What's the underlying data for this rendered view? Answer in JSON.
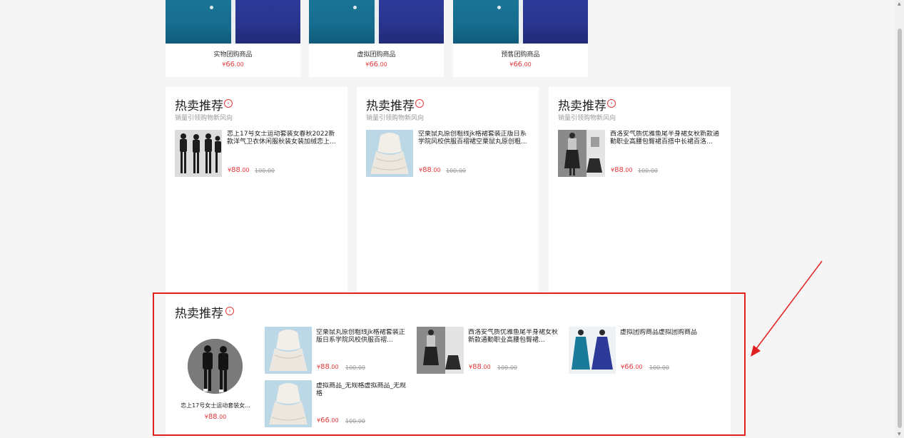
{
  "top_cards": [
    {
      "name": "实物团购商品",
      "currency": "¥",
      "price_int": "66",
      "price_dec": ".00"
    },
    {
      "name": "虚拟团购商品",
      "currency": "¥",
      "price_int": "66",
      "price_dec": ".00"
    },
    {
      "name": "预售团购商品",
      "currency": "¥",
      "price_int": "66",
      "price_dec": ".00"
    }
  ],
  "panels": [
    {
      "title": "热卖推荐",
      "subtitle": "销量引领购物新风向",
      "product_name": "恋上17号女士运动套装女春秋2022新款洋气卫衣休闲服秋装女装加绒恋上...",
      "currency": "¥",
      "price_int": "88",
      "price_dec": ".00",
      "orig_price": "100.00"
    },
    {
      "title": "热卖推荐",
      "subtitle": "销量引领购物新风向",
      "product_name": "空栗鼠丸原创粗线jk格裙套装正版日系学院风校供服百褶裙空栗鼠丸原创粗...",
      "currency": "¥",
      "price_int": "88",
      "price_dec": ".00",
      "orig_price": "100.00"
    },
    {
      "title": "热卖推荐",
      "subtitle": "销量引领购物新风向",
      "product_name": "西洛安气质优雅鱼尾半身裙女秋新款通勤职业高腰包臀裙百搭中长裙百洛...",
      "currency": "¥",
      "price_int": "88",
      "price_dec": ".00",
      "orig_price": "100.00"
    }
  ],
  "bottom": {
    "title": "热卖推荐",
    "featured": {
      "name": "恋上17号女士运动套装女...",
      "currency": "¥",
      "price_int": "88",
      "price_dec": ".00"
    },
    "items": [
      {
        "name": "空栗鼠丸原创粗线jk格裙套装正版日系学院风校供服百褶...",
        "currency": "¥",
        "price_int": "88",
        "price_dec": ".00",
        "orig_price": "100.00"
      },
      {
        "name": "西洛安气质优雅鱼尾半身裙女秋新款通勤职业高腰包臀裙...",
        "currency": "¥",
        "price_int": "88",
        "price_dec": ".00",
        "orig_price": "100.00"
      },
      {
        "name": "虚拟团购商品虚拟团购商品",
        "currency": "¥",
        "price_int": "66",
        "price_dec": ".00",
        "orig_price": "100.00"
      },
      {
        "name": "虚拟商品_无规格虚拟商品_无规格",
        "currency": "¥",
        "price_int": "66",
        "price_dec": ".00",
        "orig_price": "100.00"
      }
    ]
  },
  "icons": {
    "more": "chevron-right-circle-icon"
  },
  "colors": {
    "price": "#e4393c",
    "highlight_border": "#e02020",
    "background": "#f5f5f5"
  }
}
